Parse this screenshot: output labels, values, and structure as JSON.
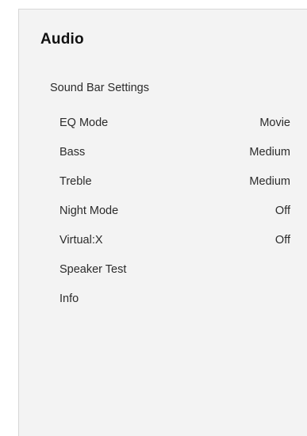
{
  "menu": {
    "title": "Audio",
    "section_label": "Sound Bar Settings",
    "items": [
      {
        "label": "EQ Mode",
        "value": "Movie"
      },
      {
        "label": "Bass",
        "value": "Medium"
      },
      {
        "label": "Treble",
        "value": "Medium"
      },
      {
        "label": "Night Mode",
        "value": "Off"
      },
      {
        "label": "Virtual:X",
        "value": "Off"
      },
      {
        "label": "Speaker Test",
        "value": ""
      },
      {
        "label": "Info",
        "value": ""
      }
    ]
  },
  "colors": {
    "panel_background": "#f3f3f3",
    "text": "#2b2b2b",
    "title_text": "#111111"
  }
}
